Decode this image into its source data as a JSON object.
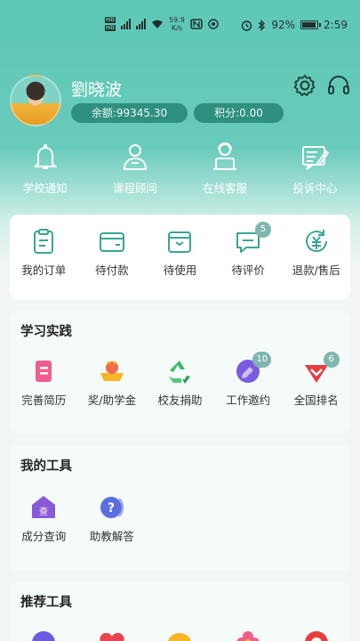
{
  "status_bar": {
    "net_speed_value": "59.9",
    "net_speed_unit": "K/s",
    "battery": "92%",
    "time": "2:59"
  },
  "profile": {
    "name": "劉晓波",
    "balance": "余额:99345.30",
    "points": "积分:0.00"
  },
  "quick_nav": [
    {
      "label": "学校通知",
      "icon": "bell-icon"
    },
    {
      "label": "课程顾问",
      "icon": "advisor-icon"
    },
    {
      "label": "在线客服",
      "icon": "customer-service-icon"
    },
    {
      "label": "投诉中心",
      "icon": "complaint-icon"
    }
  ],
  "orders": [
    {
      "label": "我的订单",
      "icon": "clipboard-icon"
    },
    {
      "label": "待付款",
      "icon": "wallet-icon"
    },
    {
      "label": "待使用",
      "icon": "box-icon"
    },
    {
      "label": "待评价",
      "icon": "comment-icon",
      "badge": "5"
    },
    {
      "label": "退款/售后",
      "icon": "refund-icon"
    }
  ],
  "practice": {
    "title": "学习实践",
    "items": [
      {
        "label": "完善简历",
        "icon": "resume-icon"
      },
      {
        "label": "奖/助学金",
        "icon": "scholarship-icon"
      },
      {
        "label": "校友捐助",
        "icon": "recycle-icon"
      },
      {
        "label": "工作邀约",
        "icon": "job-invite-icon",
        "badge": "10"
      },
      {
        "label": "全国排名",
        "icon": "ranking-icon",
        "badge": "6"
      }
    ]
  },
  "tools": {
    "title": "我的工具",
    "items": [
      {
        "label": "成分查询",
        "icon": "score-query-icon",
        "icon_text": "查"
      },
      {
        "label": "助教解答",
        "icon": "question-icon",
        "icon_text": "?"
      }
    ]
  },
  "recommend": {
    "title": "推荐工具"
  },
  "colors": {
    "header_teal": "#5ec7b6",
    "pill_bg": "#2f8f80",
    "icon_teal": "#3aa594",
    "badge": "#7fb7b0"
  }
}
